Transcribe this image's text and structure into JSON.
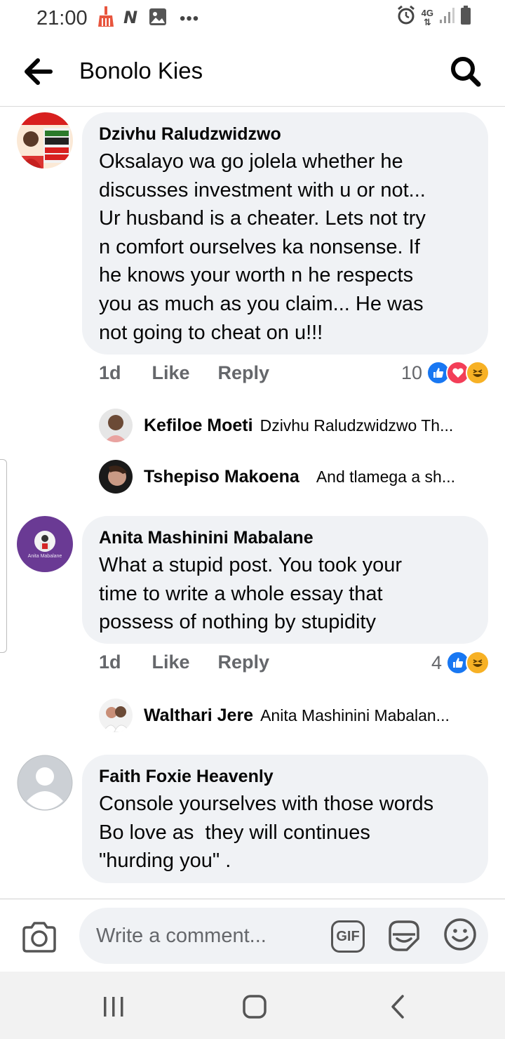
{
  "status_bar": {
    "time": "21:00",
    "network": "4G"
  },
  "header": {
    "title": "Bonolo Kies"
  },
  "comments": [
    {
      "author": "Dzivhu Raludzwidzwo",
      "text": "Oksalayo wa go jolela whether he\ndiscusses investment with u or not...\nUr husband is a cheater. Lets not try\nn comfort ourselves ka nonsense. If\nhe knows your worth n he respects\nyou as much as you claim... He was\nnot going to cheat on u!!!",
      "age": "1d",
      "like_label": "Like",
      "reply_label": "Reply",
      "reaction_count": "10",
      "replies": [
        {
          "author": "Kefiloe Moeti",
          "text": "Dzivhu Raludzwidzwo Th..."
        },
        {
          "author": "Tshepiso Makoena",
          "text": "And tlamega a sh..."
        }
      ]
    },
    {
      "author": "Anita Mashinini Mabalane",
      "avatar_caption": "Anita Mabalane",
      "text": "What a stupid post. You took your\ntime to write a whole essay that\npossess of nothing by stupidity",
      "age": "1d",
      "like_label": "Like",
      "reply_label": "Reply",
      "reaction_count": "4",
      "replies": [
        {
          "author": "Walthari Jere",
          "text": "Anita Mashinini Mabalan..."
        }
      ]
    },
    {
      "author": "Faith Foxie Heavenly",
      "text": "Console yourselves with those words\nBo love as  they will continues\n\"hurding you\" ."
    }
  ],
  "composer": {
    "placeholder": "Write a comment...",
    "gif_label": "GIF"
  },
  "colors": {
    "like_blue": "#1877f2",
    "love_red": "#f33e58",
    "haha_yellow": "#f7b125",
    "bubble_bg": "#f0f2f5",
    "meta_gray": "#65676b"
  }
}
